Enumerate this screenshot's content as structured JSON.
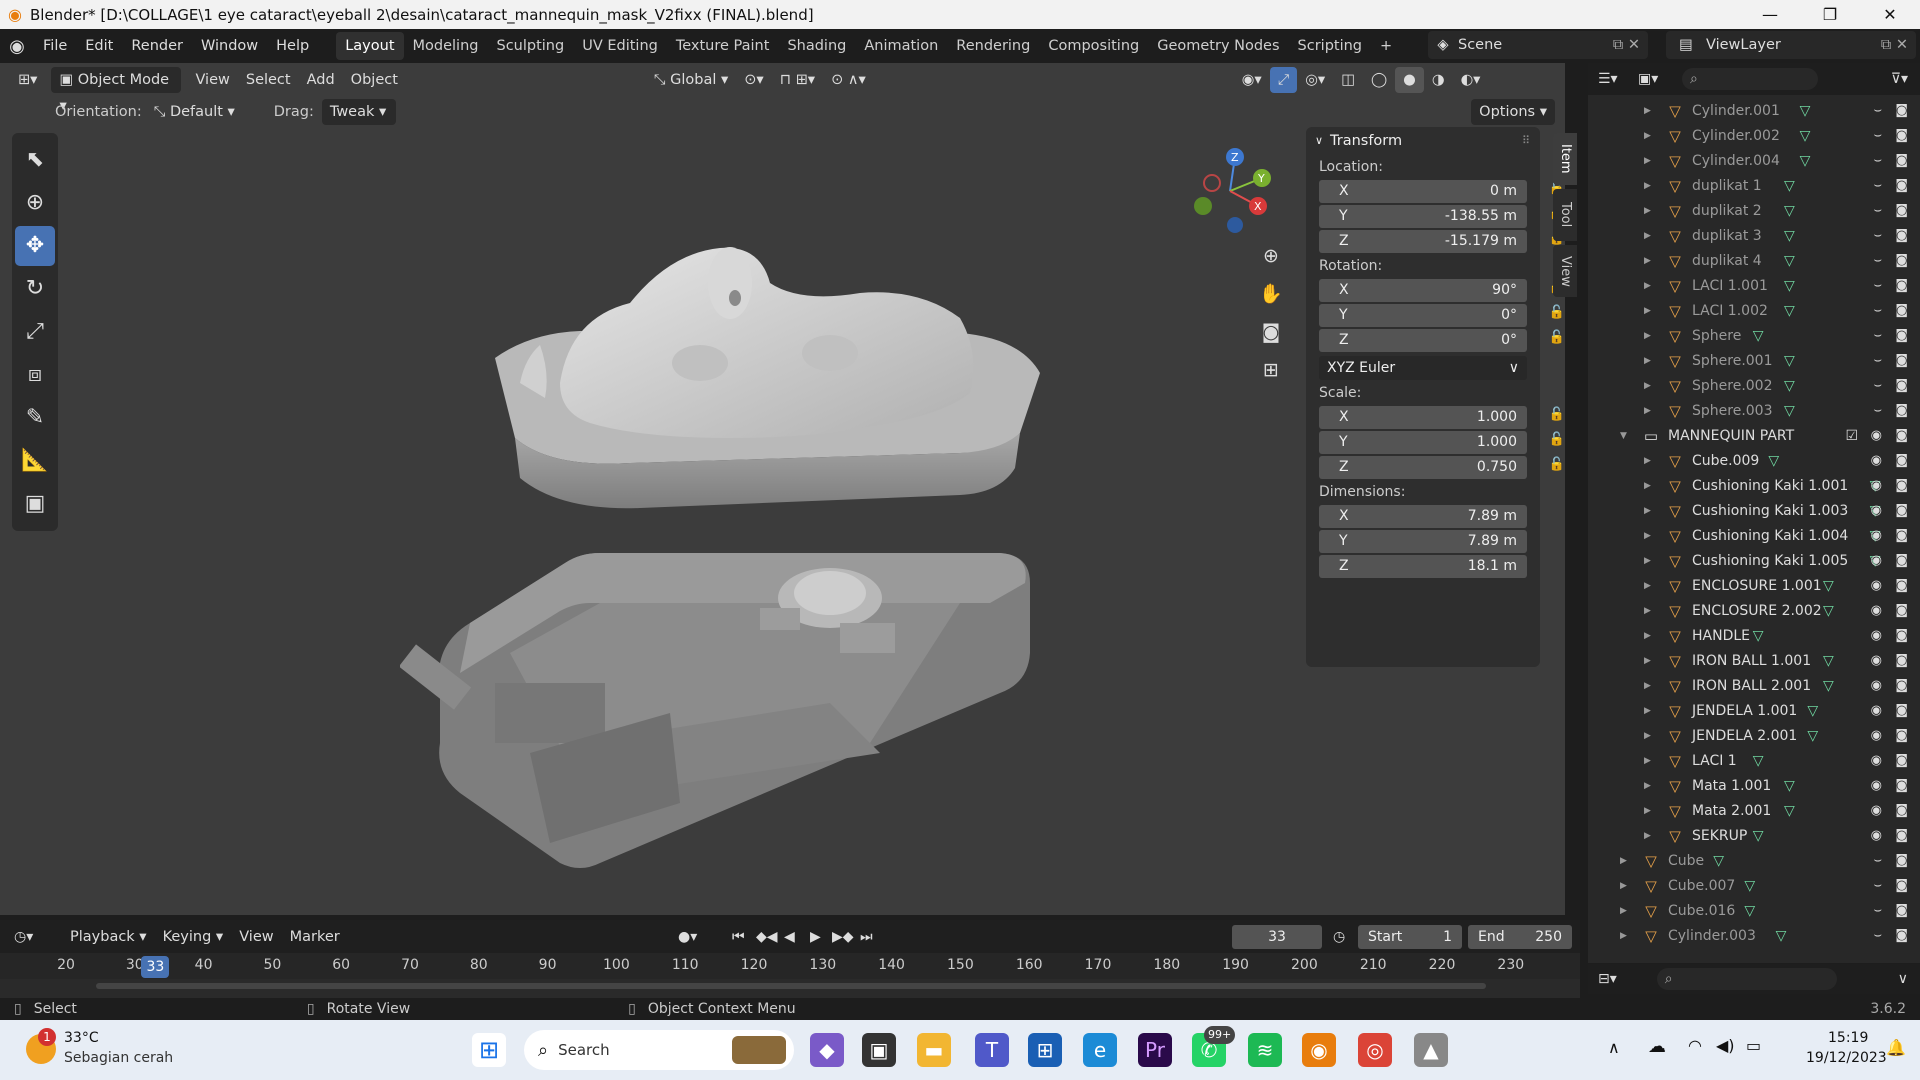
{
  "window": {
    "title": "Blender* [D:\\COLLAGE\\1 eye cataract\\eyeball 2\\desain\\cataract_mannequin_mask_V2fixx (FINAL).blend]",
    "controls": [
      "—",
      "❐",
      "✕"
    ]
  },
  "menu": [
    "File",
    "Edit",
    "Render",
    "Window",
    "Help"
  ],
  "workspaces": [
    "Layout",
    "Modeling",
    "Sculpting",
    "UV Editing",
    "Texture Paint",
    "Shading",
    "Animation",
    "Rendering",
    "Compositing",
    "Geometry Nodes",
    "Scripting",
    "+"
  ],
  "active_workspace": "Layout",
  "scene": "Scene",
  "view_layer": "ViewLayer",
  "viewport_header": {
    "mode": "Object Mode",
    "menus": [
      "View",
      "Select",
      "Add",
      "Object"
    ],
    "transform_orientation": "Global"
  },
  "tool_settings": {
    "orientation_label": "Orientation:",
    "orientation_value": "Default",
    "drag_label": "Drag:",
    "drag_value": "Tweak",
    "options": "Options"
  },
  "transform": {
    "title": "Transform",
    "location_label": "Location:",
    "location": [
      {
        "axis": "X",
        "value": "0 m"
      },
      {
        "axis": "Y",
        "value": "-138.55 m"
      },
      {
        "axis": "Z",
        "value": "-15.179 m"
      }
    ],
    "rotation_label": "Rotation:",
    "rotation": [
      {
        "axis": "X",
        "value": "90°"
      },
      {
        "axis": "Y",
        "value": "0°"
      },
      {
        "axis": "Z",
        "value": "0°"
      }
    ],
    "rotation_mode": "XYZ Euler",
    "scale_label": "Scale:",
    "scale": [
      {
        "axis": "X",
        "value": "1.000"
      },
      {
        "axis": "Y",
        "value": "1.000"
      },
      {
        "axis": "Z",
        "value": "0.750"
      }
    ],
    "dimensions_label": "Dimensions:",
    "dimensions": [
      {
        "axis": "X",
        "value": "7.89 m"
      },
      {
        "axis": "Y",
        "value": "7.89 m"
      },
      {
        "axis": "Z",
        "value": "18.1 m"
      }
    ]
  },
  "sidebar_tabs": [
    "Item",
    "Tool",
    "View"
  ],
  "gizmo_axes": [
    "Z",
    "Y",
    "X"
  ],
  "outliner": {
    "rows": [
      {
        "name": "Cylinder.001",
        "dim": true,
        "indent": 2
      },
      {
        "name": "Cylinder.002",
        "dim": true,
        "indent": 2
      },
      {
        "name": "Cylinder.004",
        "dim": true,
        "indent": 2
      },
      {
        "name": "duplikat 1",
        "dim": true,
        "indent": 2
      },
      {
        "name": "duplikat 2",
        "dim": true,
        "indent": 2
      },
      {
        "name": "duplikat 3",
        "dim": true,
        "indent": 2
      },
      {
        "name": "duplikat 4",
        "dim": true,
        "indent": 2
      },
      {
        "name": "LACI 1.001",
        "dim": true,
        "indent": 2
      },
      {
        "name": "LACI 1.002",
        "dim": true,
        "indent": 2
      },
      {
        "name": "Sphere",
        "dim": true,
        "indent": 2
      },
      {
        "name": "Sphere.001",
        "dim": true,
        "indent": 2
      },
      {
        "name": "Sphere.002",
        "dim": true,
        "indent": 2
      },
      {
        "name": "Sphere.003",
        "dim": true,
        "indent": 2
      },
      {
        "name": "MANNEQUIN PART",
        "dim": false,
        "indent": 1,
        "collection": true
      },
      {
        "name": "Cube.009",
        "dim": false,
        "indent": 2
      },
      {
        "name": "Cushioning Kaki 1.001",
        "dim": false,
        "indent": 2
      },
      {
        "name": "Cushioning Kaki 1.003",
        "dim": false,
        "indent": 2
      },
      {
        "name": "Cushioning Kaki 1.004",
        "dim": false,
        "indent": 2
      },
      {
        "name": "Cushioning Kaki 1.005",
        "dim": false,
        "indent": 2
      },
      {
        "name": "ENCLOSURE 1.001",
        "dim": false,
        "indent": 2
      },
      {
        "name": "ENCLOSURE 2.002",
        "dim": false,
        "indent": 2
      },
      {
        "name": "HANDLE",
        "dim": false,
        "indent": 2
      },
      {
        "name": "IRON BALL 1.001",
        "dim": false,
        "indent": 2
      },
      {
        "name": "IRON BALL 2.001",
        "dim": false,
        "indent": 2
      },
      {
        "name": "JENDELA 1.001",
        "dim": false,
        "indent": 2
      },
      {
        "name": "JENDELA 2.001",
        "dim": false,
        "indent": 2
      },
      {
        "name": "LACI 1",
        "dim": false,
        "indent": 2
      },
      {
        "name": "Mata 1.001",
        "dim": false,
        "indent": 2
      },
      {
        "name": "Mata 2.001",
        "dim": false,
        "indent": 2
      },
      {
        "name": "SEKRUP",
        "dim": false,
        "indent": 2
      },
      {
        "name": "Cube",
        "dim": true,
        "indent": 1
      },
      {
        "name": "Cube.007",
        "dim": true,
        "indent": 1
      },
      {
        "name": "Cube.016",
        "dim": true,
        "indent": 1
      },
      {
        "name": "Cylinder.003",
        "dim": true,
        "indent": 1
      }
    ]
  },
  "timeline": {
    "menus": [
      "Playback",
      "Keying",
      "View",
      "Marker"
    ],
    "current_frame": "33",
    "start_label": "Start",
    "start": "1",
    "end_label": "End",
    "end": "250",
    "ticks": [
      "20",
      "30",
      "40",
      "50",
      "60",
      "70",
      "80",
      "90",
      "100",
      "110",
      "120",
      "130",
      "140",
      "150",
      "160",
      "170",
      "180",
      "190",
      "200",
      "210",
      "220",
      "230"
    ]
  },
  "status": {
    "left": "Select",
    "middle": "Rotate View",
    "right": "Object Context Menu",
    "version": "3.6.2"
  },
  "taskbar": {
    "weather_temp": "33°C",
    "weather_desc": "Sebagian cerah",
    "weather_badge": "1",
    "search": "Search",
    "whatsapp_badge": "99+",
    "time": "15:19",
    "date": "19/12/2023"
  },
  "colors": {
    "accent": "#4772b3",
    "object_icon": "#e8a24a",
    "mesh_data": "#6fd6a0",
    "viewport_bg": "#3c3c3c"
  }
}
